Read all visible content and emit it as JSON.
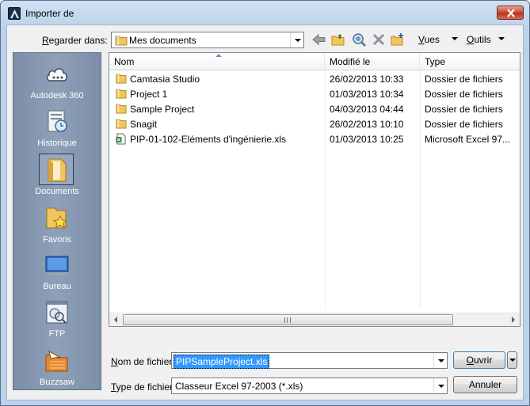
{
  "window": {
    "title": "Importer de"
  },
  "toolbar": {
    "look_in_label_prefix": "R",
    "look_in_label_rest": "egarder dans:",
    "look_in_value": "Mes documents",
    "views_label_prefix": "V",
    "views_label_rest": "ues",
    "tools_label_prefix": "O",
    "tools_label_rest": "utils"
  },
  "sidebar": {
    "items": [
      {
        "label": "Autodesk 360"
      },
      {
        "label": "Historique"
      },
      {
        "label": "Documents"
      },
      {
        "label": "Favoris"
      },
      {
        "label": "Bureau"
      },
      {
        "label": "FTP"
      },
      {
        "label": "Buzzsaw"
      }
    ]
  },
  "filelist": {
    "columns": {
      "name": "Nom",
      "date": "Modifié le",
      "type": "Type"
    },
    "rows": [
      {
        "name": "Camtasia Studio",
        "date": "26/02/2013 10:33",
        "type": "Dossier de fichiers",
        "kind": "folder"
      },
      {
        "name": "Project 1",
        "date": "01/03/2013 10:34",
        "type": "Dossier de fichiers",
        "kind": "folder"
      },
      {
        "name": "Sample Project",
        "date": "04/03/2013 04:44",
        "type": "Dossier de fichiers",
        "kind": "folder"
      },
      {
        "name": "Snagit",
        "date": "26/02/2013 10:10",
        "type": "Dossier de fichiers",
        "kind": "folder"
      },
      {
        "name": "PIP-01-102-Eléments d'ingénierie.xls",
        "date": "01/03/2013 10:25",
        "type": "Microsoft Excel 97...",
        "kind": "excel"
      }
    ]
  },
  "footer": {
    "filename_label_prefix": "N",
    "filename_label_rest": "om de fichier:",
    "filename_value": "PIPSampleProject.xls",
    "filetype_label_prefix": "T",
    "filetype_label_rest": "ype de fichier:",
    "filetype_value": "Classeur Excel 97-2003 (*.xls)",
    "open_prefix": "O",
    "open_rest": "uvrir",
    "cancel_label": "Annuler"
  },
  "colors": {
    "selection": "#3399ff",
    "sidebar": "#8fa0b8",
    "folder": "#f2c55c"
  }
}
